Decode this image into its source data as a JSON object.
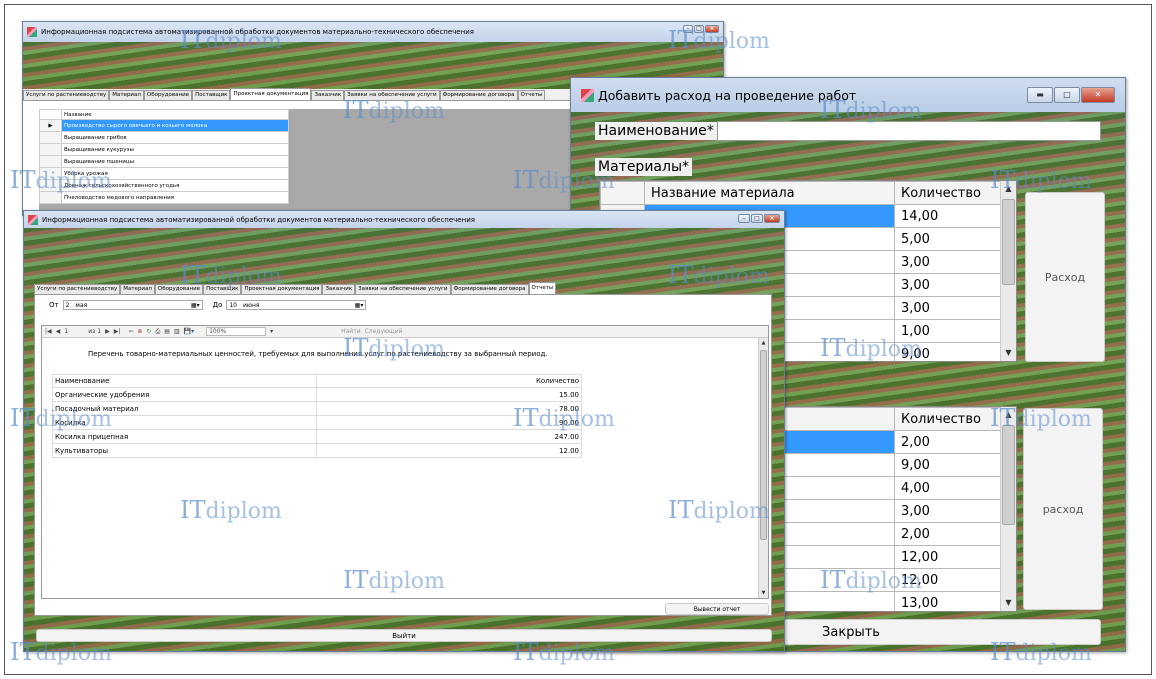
{
  "watermark": {
    "prefix": "IT",
    "suffix": "diplom"
  },
  "back_window": {
    "title": "Информационная подсистема автоматизированной обработки документов материально-технического обеспечения",
    "tabs": [
      "Услуги по растениеводству",
      "Материал",
      "Оборудование",
      "Поставщик",
      "Проектная документация",
      "Заказчик",
      "Заявки на обеспечение услуги",
      "Формирование договора",
      "Отчеты"
    ],
    "active_tab": 4,
    "table_header": "Название",
    "rows": [
      "Производство сырого овечьего и козьего молока",
      "Выращивание грибов",
      "Выращивание кукурузы",
      "Выращивание пшеницы",
      "Уборка урожая",
      "Дренаж сельскохозяйственного угодья",
      "Пчеловодство медового направления"
    ]
  },
  "dialog": {
    "title": "Добавить расход на проведение работ",
    "name_label": "Наименование*",
    "name_value": "",
    "materials_label": "Материалы*",
    "grid1": {
      "col1": "Название материала",
      "col2": "Количество",
      "values": [
        "14,00",
        "5,00",
        "3,00",
        "3,00",
        "3,00",
        "1,00",
        "9,00"
      ]
    },
    "button1": "Расход",
    "grid2": {
      "col2": "Количество",
      "values": [
        "2,00",
        "9,00",
        "4,00",
        "3,00",
        "2,00",
        "12,00",
        "12,00",
        "13,00"
      ]
    },
    "button2": "расход",
    "close_button": "Закрыть"
  },
  "front_window": {
    "title": "Информационная подсистема автоматизированной обработки документов материально-технического обеспечения",
    "tabs": [
      "Услуги по растениеводству",
      "Материал",
      "Оборудование",
      "Поставщик",
      "Проектная документация",
      "Заказчик",
      "Заявки на обеспечение услуги",
      "Формирование договора",
      "Отчеты"
    ],
    "active_tab": 8,
    "date_from_label": "От",
    "date_from_day": "2",
    "date_from_month": "мая",
    "date_to_label": "До",
    "date_to_day": "10",
    "date_to_month": "июня",
    "toolbar": {
      "page": "1",
      "of_pages": "из 1",
      "zoom": "100%",
      "find": "Найти",
      "next": "Следующий"
    },
    "report": {
      "title": "Перечень товарно-материальных ценностей, требуемых для выполнения услуг по растениеводству за выбранный период.",
      "col_name": "Наименование",
      "col_qty": "Количество",
      "rows": [
        {
          "name": "Органические удобрения",
          "qty": "15.00"
        },
        {
          "name": "Посадочный материал",
          "qty": "78.00"
        },
        {
          "name": "Косилка",
          "qty": "90.00"
        },
        {
          "name": "Косилка прицепная",
          "qty": "247.00"
        },
        {
          "name": "Культиваторы",
          "qty": "12.00"
        }
      ]
    },
    "print_button": "Вывести отчет",
    "exit_button": "Выйти"
  }
}
